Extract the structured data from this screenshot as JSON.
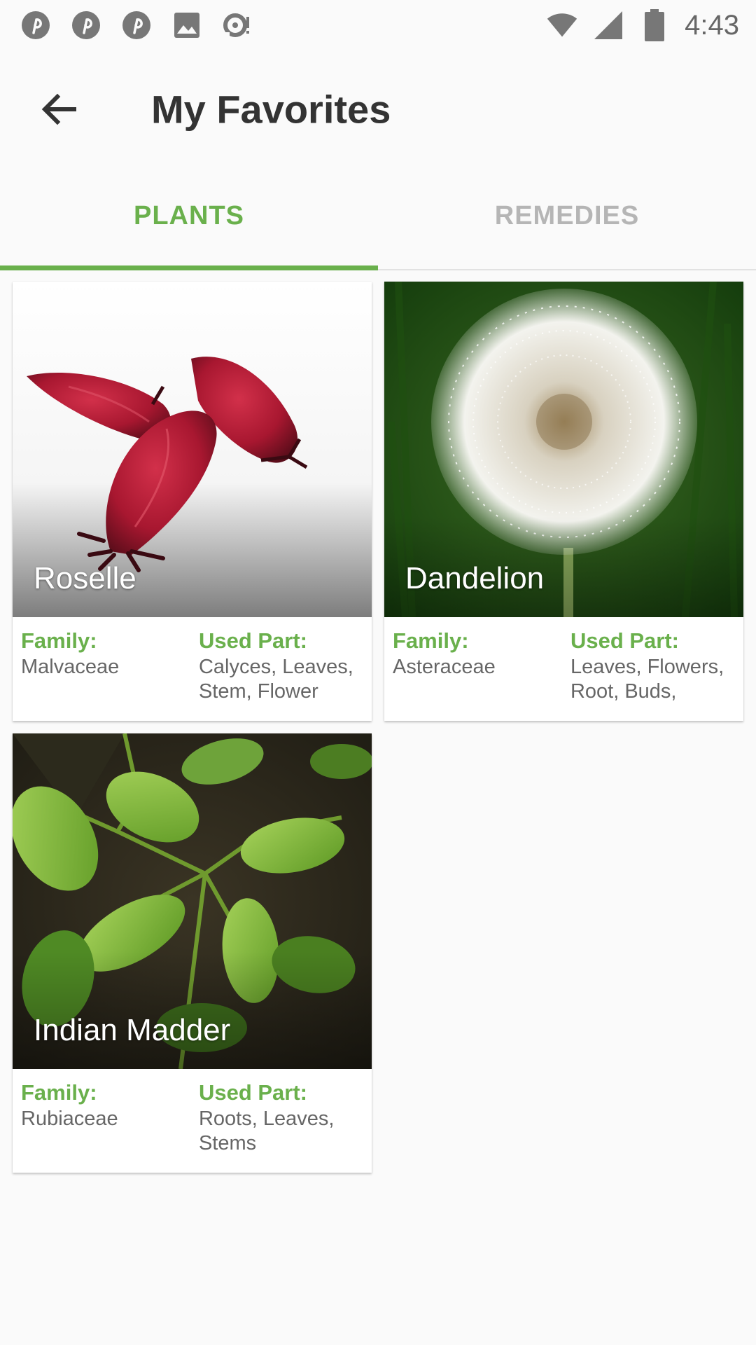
{
  "status_bar": {
    "time": "4:43",
    "left_icons": [
      "pinterest-icon",
      "pinterest-icon",
      "pinterest-icon",
      "image-icon",
      "notification-icon"
    ],
    "right_icons": [
      "wifi-icon",
      "cell-signal-icon",
      "battery-icon"
    ]
  },
  "toolbar": {
    "back_icon": "arrow-back-icon",
    "title": "My Favorites"
  },
  "tabs": [
    {
      "label": "PLANTS",
      "active": true
    },
    {
      "label": "REMEDIES",
      "active": false
    }
  ],
  "colors": {
    "accent": "#6ab04c",
    "inactive_tab": "#b5b5b5",
    "background": "#fafafa"
  },
  "plants": [
    {
      "name": "Roselle",
      "family_label": "Family:",
      "family": "Malvaceae",
      "used_part_label": "Used Part:",
      "used_part_line1": "Calyces, Leaves,",
      "used_part_line2": "Stem, Flower"
    },
    {
      "name": "Dandelion",
      "family_label": "Family:",
      "family": "Asteraceae",
      "used_part_label": "Used Part:",
      "used_part_line1": "Leaves, Flowers,",
      "used_part_line2": "Root, Buds,"
    },
    {
      "name": "Indian Madder",
      "family_label": "Family:",
      "family": "Rubiaceae",
      "used_part_label": "Used Part:",
      "used_part_line1": "Roots, Leaves,",
      "used_part_line2": "Stems"
    }
  ]
}
